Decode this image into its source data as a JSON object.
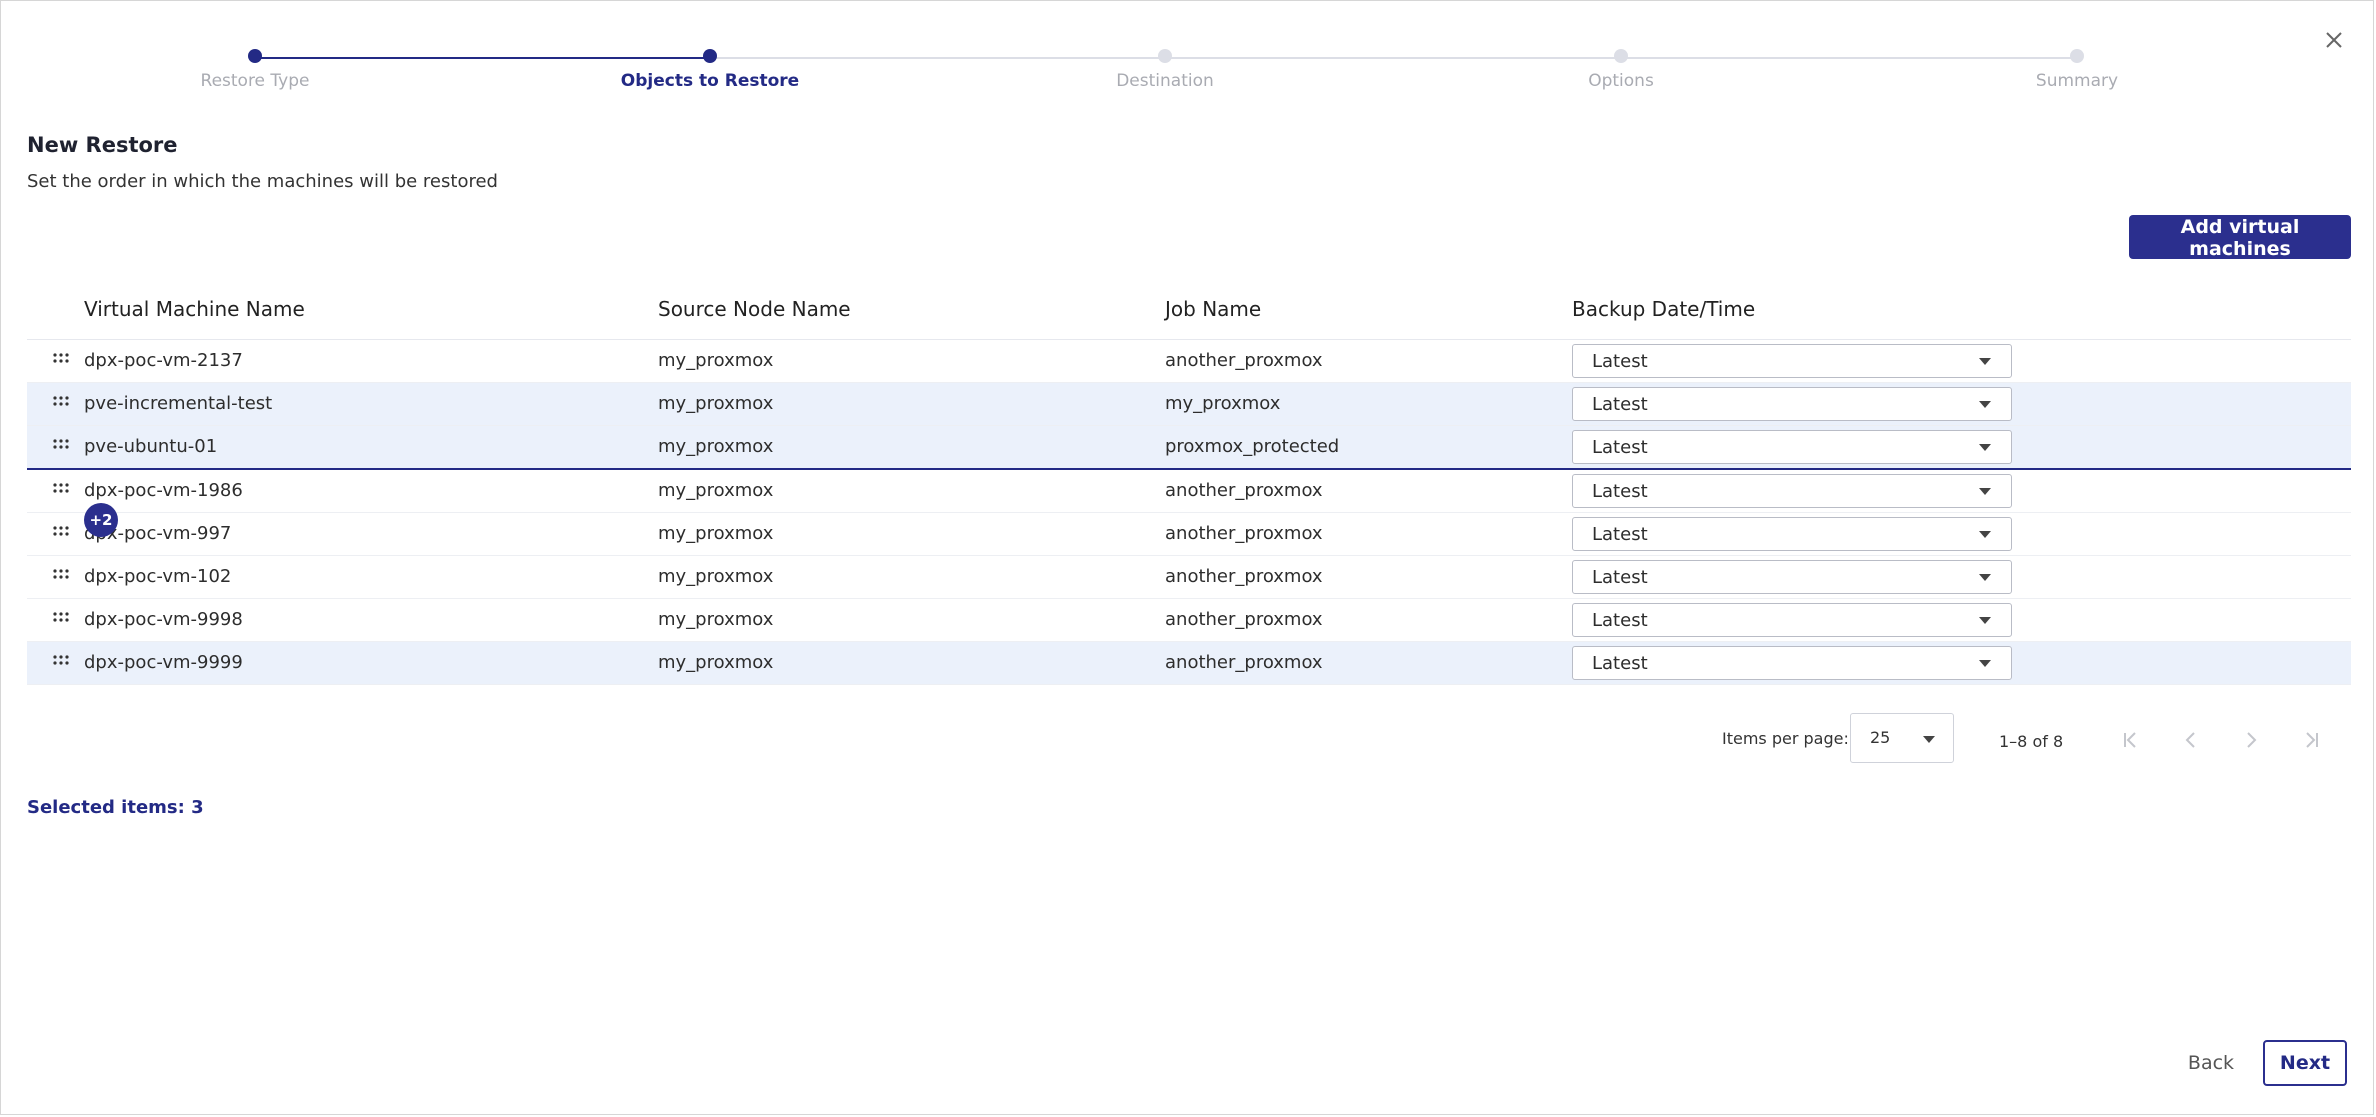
{
  "stepper": {
    "steps": [
      {
        "label": "Restore Type",
        "state": "done"
      },
      {
        "label": "Objects to Restore",
        "state": "active"
      },
      {
        "label": "Destination",
        "state": "pending"
      },
      {
        "label": "Options",
        "state": "pending"
      },
      {
        "label": "Summary",
        "state": "pending"
      }
    ]
  },
  "header": {
    "title": "New Restore",
    "subtitle": "Set the order in which the machines will be restored",
    "add_button": "Add virtual machines"
  },
  "table": {
    "columns": [
      "Virtual Machine Name",
      "Source Node Name",
      "Job Name",
      "Backup Date/Time"
    ],
    "rows": [
      {
        "vm": "dpx-poc-vm-2137",
        "node": "my_proxmox",
        "job": "another_proxmox",
        "backup": "Latest"
      },
      {
        "vm": "pve-incremental-test",
        "node": "my_proxmox",
        "job": "my_proxmox",
        "backup": "Latest"
      },
      {
        "vm": "pve-ubuntu-01",
        "node": "my_proxmox",
        "job": "proxmox_protected",
        "backup": "Latest"
      },
      {
        "vm": "dpx-poc-vm-1986",
        "node": "my_proxmox",
        "job": "another_proxmox",
        "backup": "Latest"
      },
      {
        "vm": "dpx-poc-vm-997",
        "node": "my_proxmox",
        "job": "another_proxmox",
        "backup": "Latest"
      },
      {
        "vm": "dpx-poc-vm-102",
        "node": "my_proxmox",
        "job": "another_proxmox",
        "backup": "Latest"
      },
      {
        "vm": "dpx-poc-vm-9998",
        "node": "my_proxmox",
        "job": "another_proxmox",
        "backup": "Latest"
      },
      {
        "vm": "dpx-poc-vm-9999",
        "node": "my_proxmox",
        "job": "another_proxmox",
        "backup": "Latest"
      }
    ],
    "drag_badge": "+2"
  },
  "pagination": {
    "items_per_page_label": "Items per page:",
    "items_per_page": "25",
    "range": "1–8 of 8"
  },
  "footer": {
    "selected_items": "Selected items: 3",
    "back": "Back",
    "next": "Next"
  },
  "colors": {
    "accent": "#2b2f8e",
    "selected_row": "#ebf1fb"
  }
}
